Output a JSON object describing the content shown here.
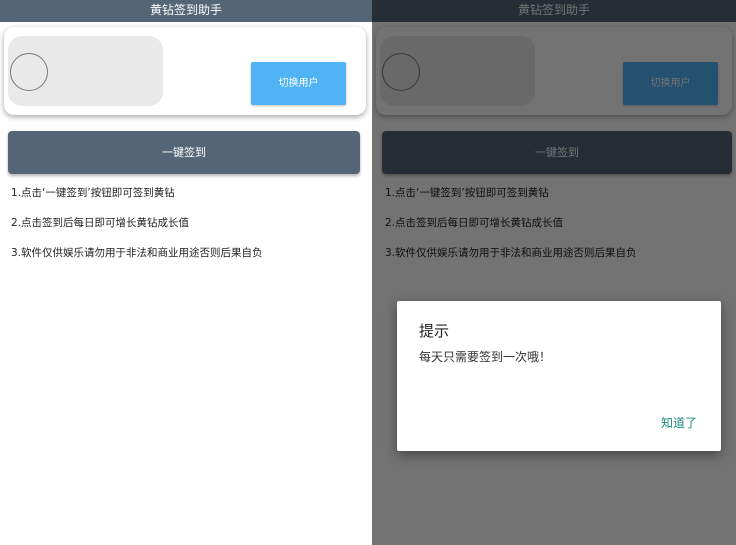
{
  "app": {
    "title": "黄钻签到助手"
  },
  "card": {
    "switch_user_label": "切换用户"
  },
  "main": {
    "checkin_label": "一键签到",
    "instructions": [
      "1.点击‘一键签到’按钮即可签到黄钻",
      "2.点击签到后每日即可增长黄钻成长值",
      "3.软件仅供娱乐请勿用于非法和商业用途否则后果自负"
    ]
  },
  "dialog": {
    "title": "提示",
    "message": "每天只需要签到一次哦！",
    "ok_label": "知道了"
  },
  "colors": {
    "titlebar": "#546575",
    "switch_button": "#4fb3f6",
    "checkin_button": "#546575",
    "dialog_action": "#1e8a7e"
  }
}
